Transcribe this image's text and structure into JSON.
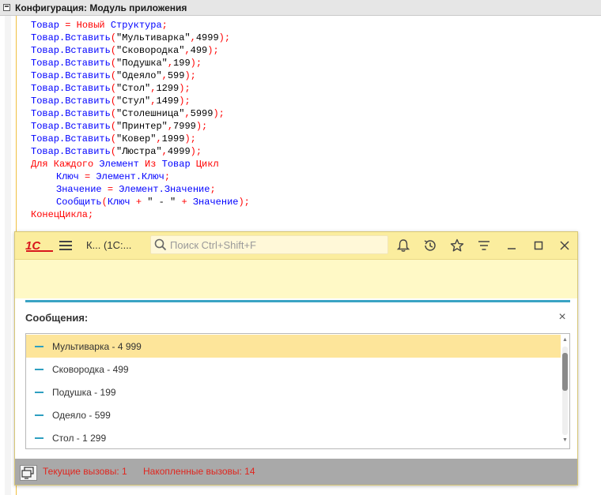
{
  "editor": {
    "title": "Конфигурация: Модуль приложения"
  },
  "code": {
    "lines": [
      [
        [
          "bl",
          "Товар "
        ],
        [
          "op",
          "="
        ],
        [
          "kw",
          " Новый "
        ],
        [
          "bl",
          "Структура"
        ],
        [
          "op",
          ";"
        ]
      ],
      [
        [
          "bl",
          "Товар.Вставить"
        ],
        [
          "op",
          "("
        ],
        [
          "st",
          "\"Мультиварка\""
        ],
        [
          "op",
          ","
        ],
        [
          "nm",
          "4999"
        ],
        [
          "op",
          ");"
        ]
      ],
      [
        [
          "bl",
          "Товар.Вставить"
        ],
        [
          "op",
          "("
        ],
        [
          "st",
          "\"Сковородка\""
        ],
        [
          "op",
          ","
        ],
        [
          "nm",
          "499"
        ],
        [
          "op",
          ");"
        ]
      ],
      [
        [
          "bl",
          "Товар.Вставить"
        ],
        [
          "op",
          "("
        ],
        [
          "st",
          "\"Подушка\""
        ],
        [
          "op",
          ","
        ],
        [
          "nm",
          "199"
        ],
        [
          "op",
          ");"
        ]
      ],
      [
        [
          "bl",
          "Товар.Вставить"
        ],
        [
          "op",
          "("
        ],
        [
          "st",
          "\"Одеяло\""
        ],
        [
          "op",
          ","
        ],
        [
          "nm",
          "599"
        ],
        [
          "op",
          ");"
        ]
      ],
      [
        [
          "bl",
          "Товар.Вставить"
        ],
        [
          "op",
          "("
        ],
        [
          "st",
          "\"Стол\""
        ],
        [
          "op",
          ","
        ],
        [
          "nm",
          "1299"
        ],
        [
          "op",
          ");"
        ]
      ],
      [
        [
          "bl",
          "Товар.Вставить"
        ],
        [
          "op",
          "("
        ],
        [
          "st",
          "\"Стул\""
        ],
        [
          "op",
          ","
        ],
        [
          "nm",
          "1499"
        ],
        [
          "op",
          ");"
        ]
      ],
      [
        [
          "bl",
          "Товар.Вставить"
        ],
        [
          "op",
          "("
        ],
        [
          "st",
          "\"Столешница\""
        ],
        [
          "op",
          ","
        ],
        [
          "nm",
          "5999"
        ],
        [
          "op",
          ");"
        ]
      ],
      [
        [
          "bl",
          "Товар.Вставить"
        ],
        [
          "op",
          "("
        ],
        [
          "st",
          "\"Принтер\""
        ],
        [
          "op",
          ","
        ],
        [
          "nm",
          "7999"
        ],
        [
          "op",
          ");"
        ]
      ],
      [
        [
          "bl",
          "Товар.Вставить"
        ],
        [
          "op",
          "("
        ],
        [
          "st",
          "\"Ковер\""
        ],
        [
          "op",
          ","
        ],
        [
          "nm",
          "1999"
        ],
        [
          "op",
          ");"
        ]
      ],
      [
        [
          "bl",
          "Товар.Вставить"
        ],
        [
          "op",
          "("
        ],
        [
          "st",
          "\"Люстра\""
        ],
        [
          "op",
          ","
        ],
        [
          "nm",
          "4999"
        ],
        [
          "op",
          ");"
        ]
      ],
      [
        [
          "kw",
          "Для Каждого "
        ],
        [
          "bl",
          "Элемент "
        ],
        [
          "kw",
          "Из "
        ],
        [
          "bl",
          "Товар "
        ],
        [
          "kw",
          "Цикл"
        ]
      ],
      [
        [
          "ind",
          ""
        ],
        [
          "bl",
          "Ключ "
        ],
        [
          "op",
          "="
        ],
        [
          "bl",
          " Элемент.Ключ"
        ],
        [
          "op",
          ";"
        ]
      ],
      [
        [
          "ind",
          ""
        ],
        [
          "bl",
          "Значение "
        ],
        [
          "op",
          "="
        ],
        [
          "bl",
          " Элемент.Значение"
        ],
        [
          "op",
          ";"
        ]
      ],
      [
        [
          "ind",
          ""
        ],
        [
          "bl",
          "Сообщить"
        ],
        [
          "op",
          "("
        ],
        [
          "bl",
          "Ключ "
        ],
        [
          "op",
          "+"
        ],
        [
          "st",
          " \" - \" "
        ],
        [
          "op",
          "+"
        ],
        [
          "bl",
          " Значение"
        ],
        [
          "op",
          ");"
        ]
      ],
      [
        [
          "kw",
          "КонецЦикла"
        ],
        [
          "op",
          ";"
        ]
      ]
    ]
  },
  "client": {
    "app_title": "К...  (1С:...",
    "search_placeholder": "Поиск Ctrl+Shift+F",
    "toolbar_icons": [
      "bell-icon",
      "history-icon",
      "star-icon",
      "menu-settings-icon",
      "minimize-icon",
      "maximize-icon",
      "close-icon"
    ]
  },
  "messages": {
    "header": "Сообщения:",
    "close_glyph": "×",
    "items": [
      "Мультиварка - 4 999",
      "Сковородка - 499",
      "Подушка - 199",
      "Одеяло - 599",
      "Стол - 1 299"
    ],
    "selected_index": 0
  },
  "status": {
    "current_calls": "Текущие вызовы: 1",
    "accumulated_calls": "Накопленные вызовы: 14"
  },
  "colors": {
    "keyword": "#ff0000",
    "identifier": "#0000ff",
    "string": "#000000",
    "header_yellow": "#fbed9e",
    "accent_blue": "#3aa3c4",
    "status_red": "#e0261f"
  }
}
